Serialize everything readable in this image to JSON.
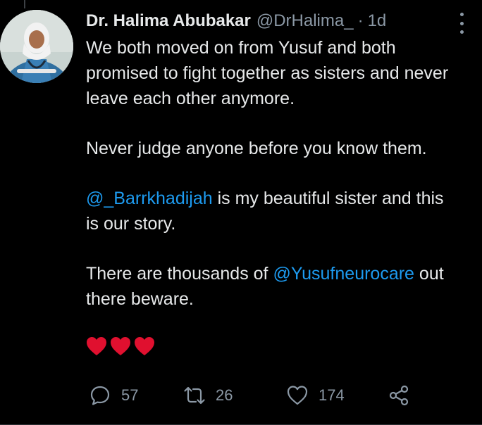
{
  "tweet": {
    "author_name": "Dr. Halima Abubakar",
    "author_handle": "@DrHalima_",
    "separator": "·",
    "time": "1d",
    "paragraph1": "We both moved on from Yusuf and both promised to fight together as sisters and never leave each other anymore.",
    "paragraph2": "Never judge anyone before you know them.",
    "mention1": "@_Barrkhadijah",
    "paragraph3_rest": " is my beautiful sister and this is our story.",
    "paragraph4_start": "There are thousands of ",
    "mention2": "@Yusufneurocare",
    "paragraph4_end": " out there beware.",
    "emoji": [
      "heart-emoji",
      "heart-emoji",
      "heart-emoji"
    ]
  },
  "actions": {
    "replies": "57",
    "retweets": "26",
    "likes": "174"
  },
  "colors": {
    "background": "#000000",
    "text": "#e7e9ea",
    "muted": "#8b98a5",
    "link": "#1d9bf0",
    "heart": "#e0102f"
  }
}
